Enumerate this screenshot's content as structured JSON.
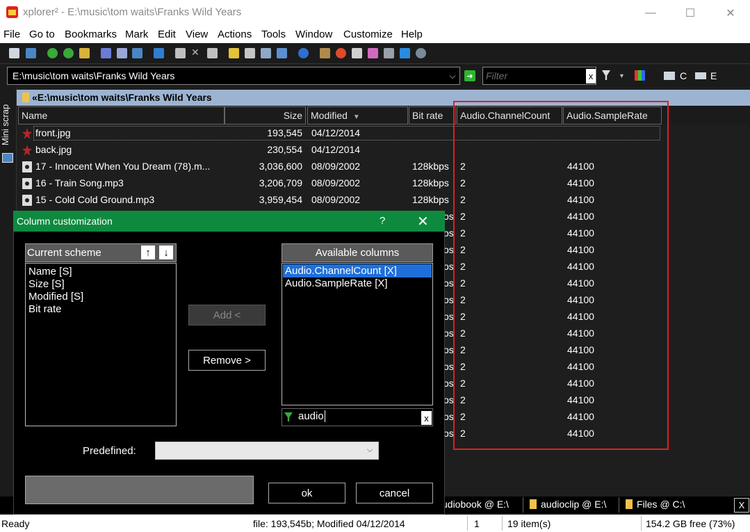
{
  "window": {
    "title": "xplorer² - E:\\music\\tom waits\\Franks Wild Years",
    "minimize": "—",
    "maximize": "☐",
    "close": "✕"
  },
  "menu": [
    "File",
    "Go to",
    "Bookmarks",
    "Mark",
    "Edit",
    "View",
    "Actions",
    "Tools",
    "Window",
    "Customize",
    "Help"
  ],
  "address": {
    "path": "E:\\music\\tom waits\\Franks Wild Years",
    "filter_placeholder": "Filter",
    "filter_clear": "x",
    "drive_c": "C",
    "drive_e": "E"
  },
  "sidebar": {
    "label": "Mini scrap"
  },
  "pane": {
    "header": "«E:\\music\\tom waits\\Franks Wild Years",
    "columns": [
      "Name",
      "Size",
      "Modified",
      "Bit rate",
      "Audio.ChannelCount",
      "Audio.SampleRate"
    ],
    "rows": [
      {
        "name": "front.jpg",
        "size": "193,545",
        "modified": "04/12/2014",
        "bitrate": "",
        "channels": "",
        "samplerate": ""
      },
      {
        "name": "back.jpg",
        "size": "230,554",
        "modified": "04/12/2014",
        "bitrate": "",
        "channels": "",
        "samplerate": ""
      },
      {
        "name": "17 - Innocent When You Dream (78).m...",
        "size": "3,036,600",
        "modified": "08/09/2002",
        "bitrate": "128kbps",
        "channels": "2",
        "samplerate": "44100"
      },
      {
        "name": "16 - Train Song.mp3",
        "size": "3,206,709",
        "modified": "08/09/2002",
        "bitrate": "128kbps",
        "channels": "2",
        "samplerate": "44100"
      },
      {
        "name": "15 - Cold Cold Ground.mp3",
        "size": "3,959,454",
        "modified": "08/09/2002",
        "bitrate": "128kbps",
        "channels": "2",
        "samplerate": "44100"
      }
    ],
    "hidden_rows": [
      {
        "bitrate_tail": "os",
        "channels": "2",
        "samplerate": "44100"
      },
      {
        "bitrate_tail": "os",
        "channels": "2",
        "samplerate": "44100"
      },
      {
        "bitrate_tail": "os",
        "channels": "2",
        "samplerate": "44100"
      },
      {
        "bitrate_tail": "os",
        "channels": "2",
        "samplerate": "44100"
      },
      {
        "bitrate_tail": "os",
        "channels": "2",
        "samplerate": "44100"
      },
      {
        "bitrate_tail": "os",
        "channels": "2",
        "samplerate": "44100"
      },
      {
        "bitrate_tail": "os",
        "channels": "2",
        "samplerate": "44100"
      },
      {
        "bitrate_tail": "os",
        "channels": "2",
        "samplerate": "44100"
      },
      {
        "bitrate_tail": "os",
        "channels": "2",
        "samplerate": "44100"
      },
      {
        "bitrate_tail": "os",
        "channels": "2",
        "samplerate": "44100"
      },
      {
        "bitrate_tail": "os",
        "channels": "2",
        "samplerate": "44100"
      },
      {
        "bitrate_tail": "os",
        "channels": "2",
        "samplerate": "44100"
      },
      {
        "bitrate_tail": "os",
        "channels": "2",
        "samplerate": "44100"
      },
      {
        "bitrate_tail": "os",
        "channels": "2",
        "samplerate": "44100"
      }
    ]
  },
  "tabs": [
    "udiobook @ E:\\",
    "audioclip @ E:\\",
    "Files @ C:\\"
  ],
  "tabs_close": "X",
  "status": {
    "ready": "Ready",
    "file_info": "file: 193,545b; Modified 04/12/2014",
    "selected": "1",
    "items": "19 item(s)",
    "free": "154.2 GB free (73%)"
  },
  "dialog": {
    "title": "Column customization",
    "help": "?",
    "close": "✕",
    "current_scheme_label": "Current scheme",
    "current_scheme": [
      "Name [S]",
      "Size [S]",
      "Modified [S]",
      "Bit rate"
    ],
    "available_label": "Available columns",
    "available": [
      "Audio.ChannelCount [X]",
      "Audio.SampleRate [X]"
    ],
    "search_value": "audio",
    "search_clear": "x",
    "add_label": "Add <",
    "remove_label": "Remove >",
    "predefined_label": "Predefined:",
    "ok_label": "ok",
    "cancel_label": "cancel"
  },
  "colors": {
    "accent_green": "#0e8a3f",
    "selection_blue": "#1e6fd9",
    "highlight_red": "#e02020",
    "pane_header": "#9cb4d2"
  }
}
